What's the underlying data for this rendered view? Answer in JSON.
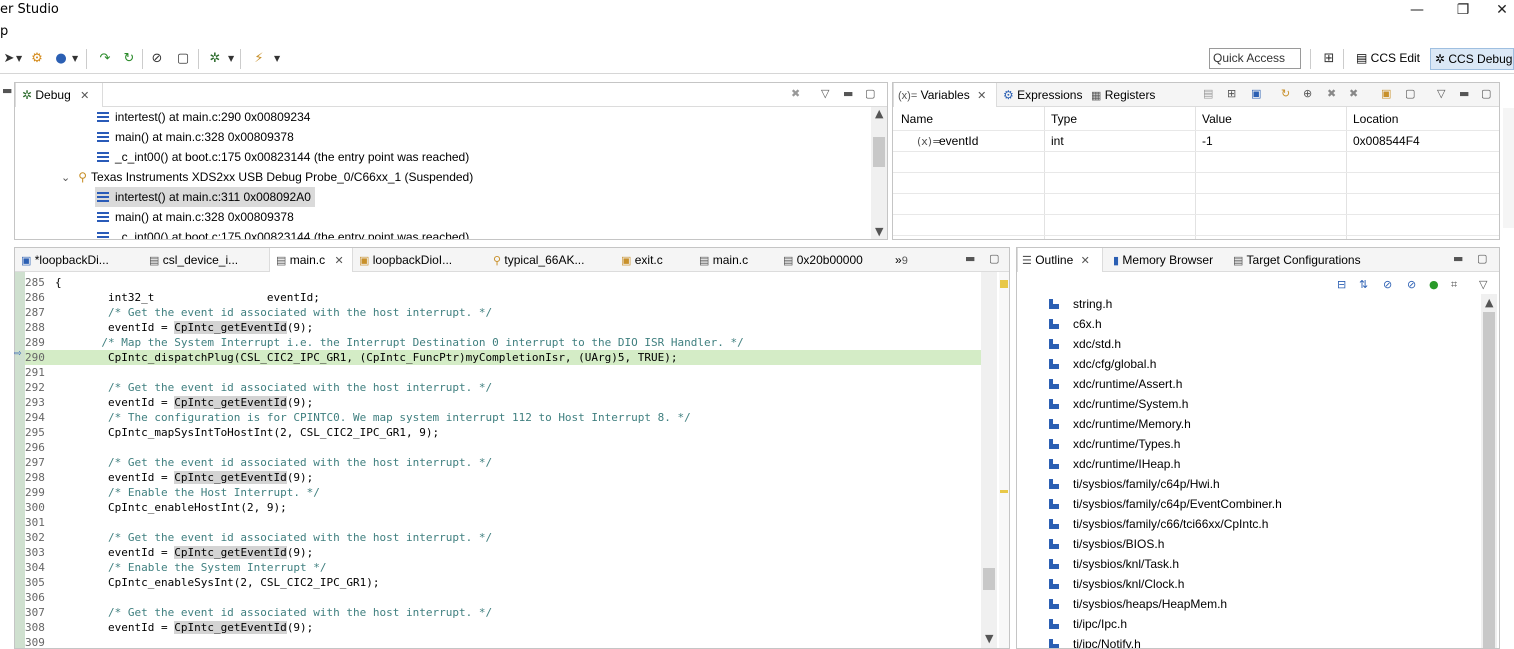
{
  "window": {
    "title": "er Studio",
    "min": "—",
    "restore": "❐",
    "close": "✕"
  },
  "menu": {
    "item": "p"
  },
  "toolbar": {
    "quick_access_placeholder": "Quick Access",
    "perspective_edit": "CCS Edit",
    "perspective_debug": "CCS Debug"
  },
  "debug": {
    "tab": "Debug",
    "rows": [
      {
        "label": "intertest() at main.c:290 0x00809234"
      },
      {
        "label": "main() at main.c:328 0x00809378"
      },
      {
        "label": "_c_int00() at boot.c:175 0x00823144  (the entry point was reached)"
      },
      {
        "label": "Texas Instruments XDS2xx USB Debug Probe_0/C66xx_1 (Suspended)"
      },
      {
        "label": "intertest() at main.c:311 0x008092A0"
      },
      {
        "label": "main() at main.c:328 0x00809378"
      },
      {
        "label": "_c_int00() at boot.c:175 0x00823144  (the entry point was reached)"
      }
    ]
  },
  "variables": {
    "tabs": [
      "Variables",
      "Expressions",
      "Registers"
    ],
    "columns": [
      "Name",
      "Type",
      "Value",
      "Location"
    ],
    "row": {
      "name": "eventId",
      "type": "int",
      "value": "-1",
      "location": "0x008544F4"
    },
    "name_prefix": "(x)="
  },
  "editor": {
    "tabs": [
      "*loopbackDi...",
      "csl_device_i...",
      "main.c",
      "loopbackDioI...",
      "typical_66AK...",
      "exit.c",
      "main.c",
      "0x20b00000"
    ],
    "overflow": "»",
    "overflow_count": "9",
    "lines": [
      {
        "n": "285",
        "t": "{"
      },
      {
        "n": "286",
        "t": "        int32_t                 eventId;"
      },
      {
        "n": "287",
        "t": "        /* Get the event id associated with the host interrupt. */"
      },
      {
        "n": "288",
        "t": "        eventId = CpIntc_getEventId(9);"
      },
      {
        "n": "289",
        "t": "       /* Map the System Interrupt i.e. the Interrupt Destination 0 interrupt to the DIO ISR Handler. */"
      },
      {
        "n": "290",
        "t": "        CpIntc_dispatchPlug(CSL_CIC2_IPC_GR1, (CpIntc_FuncPtr)myCompletionIsr, (UArg)5, TRUE);"
      },
      {
        "n": "291",
        "t": ""
      },
      {
        "n": "292",
        "t": "        /* Get the event id associated with the host interrupt. */"
      },
      {
        "n": "293",
        "t": "        eventId = CpIntc_getEventId(9);"
      },
      {
        "n": "294",
        "t": "        /* The configuration is for CPINTC0. We map system interrupt 112 to Host Interrupt 8. */"
      },
      {
        "n": "295",
        "t": "        CpIntc_mapSysIntToHostInt(2, CSL_CIC2_IPC_GR1, 9);"
      },
      {
        "n": "296",
        "t": ""
      },
      {
        "n": "297",
        "t": "        /* Get the event id associated with the host interrupt. */"
      },
      {
        "n": "298",
        "t": "        eventId = CpIntc_getEventId(9);"
      },
      {
        "n": "299",
        "t": "        /* Enable the Host Interrupt. */"
      },
      {
        "n": "300",
        "t": "        CpIntc_enableHostInt(2, 9);"
      },
      {
        "n": "301",
        "t": ""
      },
      {
        "n": "302",
        "t": "        /* Get the event id associated with the host interrupt. */"
      },
      {
        "n": "303",
        "t": "        eventId = CpIntc_getEventId(9);"
      },
      {
        "n": "304",
        "t": "        /* Enable the System Interrupt */"
      },
      {
        "n": "305",
        "t": "        CpIntc_enableSysInt(2, CSL_CIC2_IPC_GR1);"
      },
      {
        "n": "306",
        "t": ""
      },
      {
        "n": "307",
        "t": "        /* Get the event id associated with the host interrupt. */"
      },
      {
        "n": "308",
        "t": "        eventId = CpIntc_getEventId(9);"
      },
      {
        "n": "309",
        "t": ""
      }
    ]
  },
  "outline": {
    "tabs": [
      "Outline",
      "Memory Browser",
      "Target Configurations"
    ],
    "items": [
      "string.h",
      "c6x.h",
      "xdc/std.h",
      "xdc/cfg/global.h",
      "xdc/runtime/Assert.h",
      "xdc/runtime/System.h",
      "xdc/runtime/Memory.h",
      "xdc/runtime/Types.h",
      "xdc/runtime/IHeap.h",
      "ti/sysbios/family/c64p/Hwi.h",
      "ti/sysbios/family/c64p/EventCombiner.h",
      "ti/sysbios/family/c66/tci66xx/CpIntc.h",
      "ti/sysbios/BIOS.h",
      "ti/sysbios/knl/Task.h",
      "ti/sysbios/knl/Clock.h",
      "ti/sysbios/heaps/HeapMem.h",
      "ti/ipc/Ipc.h",
      "ti/ipc/Notify.h"
    ]
  },
  "colors": {
    "accent": "#2b5fb3",
    "exec_line": "#d4ecc6",
    "comment": "#3f7f7f"
  }
}
